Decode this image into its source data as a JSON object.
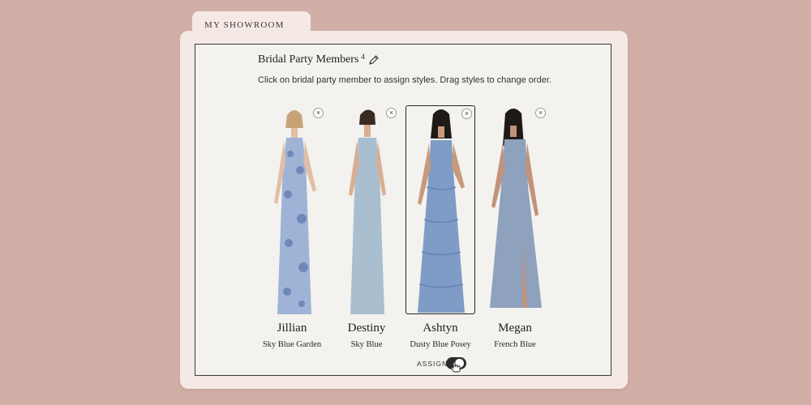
{
  "showroom": {
    "tab_label": "MY SHOWROOM"
  },
  "header": {
    "title": "Bridal Party Members",
    "count": "4",
    "instructions": "Click on bridal party member to assign styles. Drag styles to change order."
  },
  "members": [
    {
      "name": "Jillian",
      "style": "Sky Blue Garden",
      "dress_color": "#9fb3d6",
      "remove_icon": "close-icon"
    },
    {
      "name": "Destiny",
      "style": "Sky Blue",
      "dress_color": "#a9bfd0",
      "remove_icon": "close-icon"
    },
    {
      "name": "Ashtyn",
      "style": "Dusty Blue Posey",
      "dress_color": "#7f9cc6",
      "remove_icon": "close-icon"
    },
    {
      "name": "Megan",
      "style": "French Blue",
      "dress_color": "#8ea1bd",
      "remove_icon": "close-icon"
    }
  ],
  "assign": {
    "label": "ASSIGN"
  },
  "colors": {
    "background": "#d2afa6",
    "panel": "#f5e9e6",
    "inner": "#f3f2ee"
  }
}
